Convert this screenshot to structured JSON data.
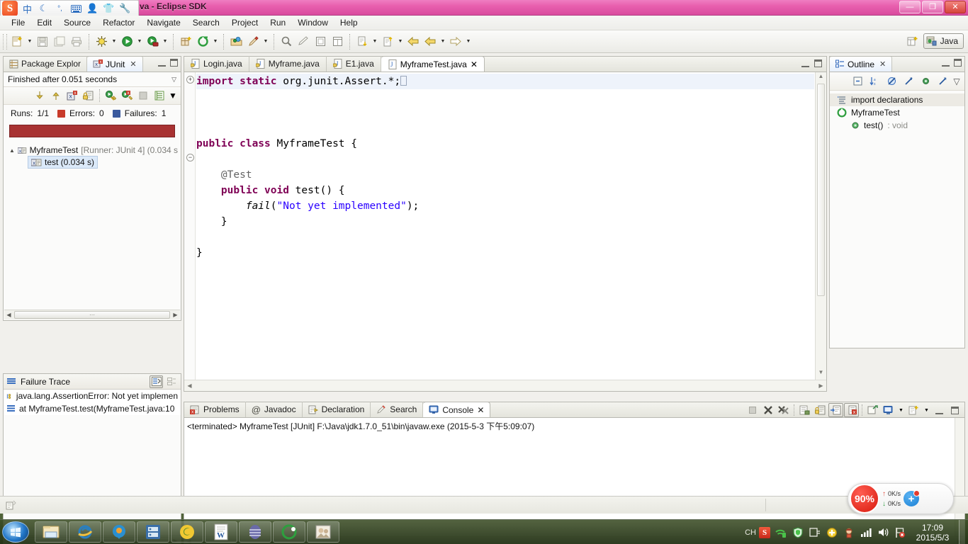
{
  "window": {
    "title": "va - Eclipse SDK",
    "controls": {
      "minimize": "—",
      "restore": "❐",
      "close": "✕"
    }
  },
  "ime_bar": {
    "logo": "S",
    "icons": [
      "中",
      "moon-icon",
      "punctuation-icon",
      "keyboard-icon",
      "user-icon",
      "skin-icon",
      "wrench-icon"
    ]
  },
  "menubar": {
    "items": [
      "File",
      "Edit",
      "Source",
      "Refactor",
      "Navigate",
      "Search",
      "Project",
      "Run",
      "Window",
      "Help"
    ]
  },
  "toolbar": {
    "perspective_new_tooltip": "Open Perspective",
    "perspective_label": "Java"
  },
  "junit": {
    "tabs": [
      {
        "label": "Package Explor",
        "icon": "package-explorer-icon",
        "active": false
      },
      {
        "label": "JUnit",
        "icon": "junit-icon",
        "active": true,
        "close": "✕"
      }
    ],
    "status": "Finished after 0.051 seconds",
    "counters": {
      "runs_label": "Runs:",
      "runs_value": "1/1",
      "errors_label": "Errors:",
      "errors_value": "0",
      "failures_label": "Failures:",
      "failures_value": "1"
    },
    "progress_color": "#a83232",
    "tree": [
      {
        "label": "MyframeTest",
        "suffix": "[Runner: JUnit 4] (0.034 s",
        "selected": false,
        "indent": 0
      },
      {
        "label": "test (0.034 s)",
        "suffix": "",
        "selected": true,
        "indent": 1
      }
    ]
  },
  "failure_trace": {
    "title": "Failure Trace",
    "rows": [
      "java.lang.AssertionError: Not yet implemen",
      "at MyframeTest.test(MyframeTest.java:10"
    ]
  },
  "editor": {
    "tabs": [
      {
        "label": "Login.java",
        "active": false
      },
      {
        "label": "Myframe.java",
        "active": false
      },
      {
        "label": "E1.java",
        "active": false
      },
      {
        "label": "MyframeTest.java",
        "active": true,
        "close": "✕"
      }
    ],
    "code_lines": [
      "import static org.junit.Assert.*;",
      "",
      "",
      "public class MyframeTest {",
      "",
      "    @Test",
      "    public void test() {",
      "        fail(\"Not yet implemented\");",
      "    }",
      "",
      "}"
    ],
    "colors": {
      "keyword": "#7f0055",
      "string": "#2a00ff",
      "annotation": "#646464"
    }
  },
  "outline": {
    "tab_label": "Outline",
    "tab_close": "✕",
    "items": [
      {
        "label": "import declarations",
        "type": "",
        "icon": "import-declarations-icon",
        "selected": true,
        "indent": 0
      },
      {
        "label": "MyframeTest",
        "type": "",
        "icon": "class-icon",
        "selected": false,
        "indent": 0
      },
      {
        "label": "test()",
        "type": " : void",
        "icon": "method-public-icon",
        "selected": false,
        "indent": 1
      }
    ]
  },
  "console": {
    "tabs": [
      {
        "label": "Problems",
        "icon": "problems-icon",
        "active": false
      },
      {
        "label": "Javadoc",
        "icon": "javadoc-icon",
        "active": false
      },
      {
        "label": "Declaration",
        "icon": "declaration-icon",
        "active": false
      },
      {
        "label": "Search",
        "icon": "search-icon",
        "active": false
      },
      {
        "label": "Console",
        "icon": "console-icon",
        "active": true,
        "close": "✕"
      }
    ],
    "line": "<terminated> MyframeTest [JUnit] F:\\Java\\jdk1.7.0_51\\bin\\javaw.exe (2015-5-3 下午5:09:07)"
  },
  "net_widget": {
    "cpu_percent": "90%",
    "upload": "0K/s",
    "download": "0K/s",
    "up_arrow": "↑",
    "down_arrow": "↓",
    "plus": "+"
  },
  "taskbar": {
    "start_label": "start-orb",
    "items": [
      "windows-explorer-icon",
      "internet-explorer-icon",
      "qq-player-icon",
      "media-app-icon",
      "sogou-icon",
      "word-icon",
      "browser-egg-icon",
      "green-browser-icon",
      "photo-viewer-icon"
    ],
    "tray": {
      "ime_label": "CH",
      "ime_logo": "S",
      "icons": [
        "wifi-icon",
        "shield-icon",
        "network-icon",
        "update-icon",
        "pet-icon",
        "signal-icon",
        "volume-icon",
        "flag-icon"
      ]
    },
    "clock_time": "17:09",
    "clock_date": "2015/5/3"
  }
}
